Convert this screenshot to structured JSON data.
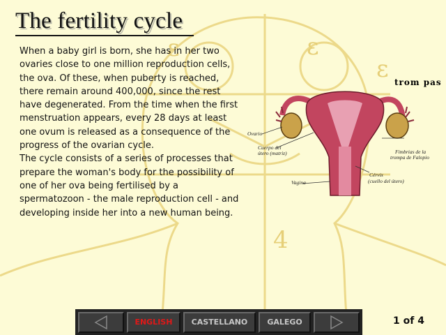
{
  "title": "The fertility cycle",
  "paragraphs": [
    "When a baby girl is born, she has in her two ovaries close to one million reproduction cells, the ova. Of these, when puberty is reached, there remain around 400,000, since the rest have degenerated. From the time when the first menstruation appears, every 28 days at least one ovum is released as a consequence of the progress of the ovarian cycle.",
    "The cycle consists of a series of processes that prepare the woman's body for the possibility of one of her ova being fertilised by a spermatozoon - the male reproduction cell - and developing inside her into a new human being."
  ],
  "diagram": {
    "trompas_label": "trom pas",
    "labels": {
      "ovario": "Ovario",
      "cuerpo_line1": "Cuerpo del",
      "cuerpo_line2": "útero (matriz)",
      "vagina": "Vagina",
      "cervix_line1": "Cérvix",
      "cervix_line2": "(cuello del útero)",
      "fimbrias_line1": "Fimbrias de la",
      "fimbrias_line2": "trompa de Falopio"
    },
    "colors": {
      "uterus": "#c2455f",
      "ovary": "#caa24a"
    }
  },
  "toolbar": {
    "prev_icon": "left-triangle-arrow",
    "next_icon": "right-triangle-arrow",
    "languages": [
      "ENGLISH",
      "CASTELLANO",
      "GALEGO"
    ],
    "active_language": "ENGLISH",
    "active_color": "#e01818"
  },
  "page_indicator": "1 of 4"
}
